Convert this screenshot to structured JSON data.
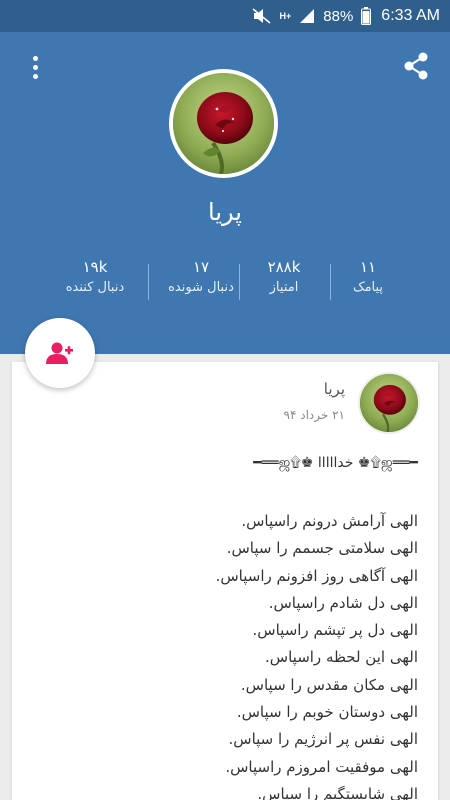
{
  "status_bar": {
    "network_type": "H+",
    "battery": "88%",
    "time": "6:33 AM",
    "icons": [
      "mute-icon",
      "signal-icon",
      "battery-icon"
    ]
  },
  "header": {
    "name": "پریا",
    "stats": [
      {
        "value": "۱۱",
        "label": "پیامک"
      },
      {
        "value": "۲۸۸k",
        "label": "امتیاز"
      },
      {
        "value": "۱۷",
        "label": "دنبال شونده"
      },
      {
        "value": "۱۹k",
        "label": "دنبال کننده"
      }
    ],
    "colors": {
      "header": "#3f77b0",
      "status_bar": "#2f5f8c",
      "accent": "#e91e63"
    }
  },
  "post": {
    "author": "پریا",
    "date": "۲۱ خرداد ۹۴",
    "headline": "━══ஜ۩♚ خدااااا ♚۩ஜ══━",
    "lines": [
      "الهی آرامش درونم راسپاس.",
      "الهی سلامتی جسمم را سپاس.",
      "الهی آگاهی روز افزونم راسپاس.",
      "الهی دل شادم راسپاس.",
      "الهی دل پر تپشم راسپاس.",
      "الهی این لحظه راسپاس.",
      "الهی مکان مقدس را سپاس.",
      "الهی دوستان خوبم را سپاس.",
      "الهی نفس پر انرژیم را سپاس.",
      "الهی موفقیت امروزم راسپاس.",
      "الهی شایستگیم را سپاس."
    ]
  }
}
